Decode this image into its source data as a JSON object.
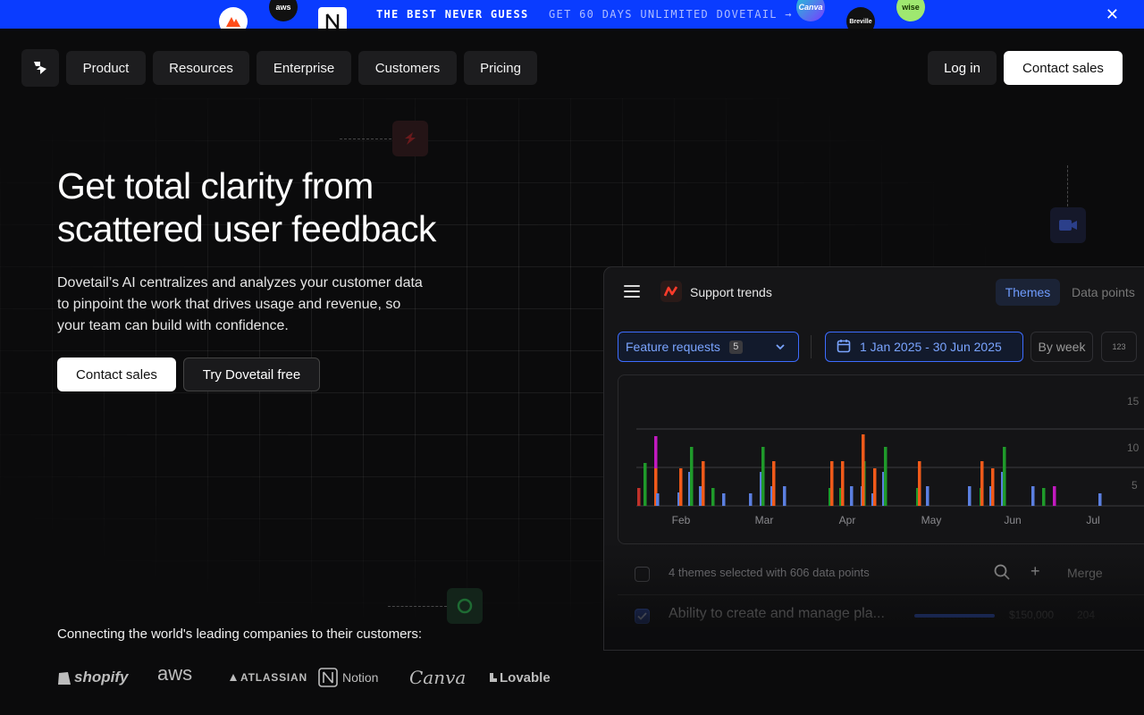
{
  "banner": {
    "headline": "THE BEST NEVER GUESS",
    "cta": "GET 60 DAYS UNLIMITED DOVETAIL →",
    "close_icon": "close-icon",
    "logos": [
      "aws",
      "Canva",
      "Breville",
      "wise"
    ]
  },
  "nav": {
    "items": [
      "Product",
      "Resources",
      "Enterprise",
      "Customers",
      "Pricing"
    ],
    "login": "Log in",
    "contact": "Contact sales"
  },
  "hero": {
    "title_line1": "Get total clarity from",
    "title_line2": "scattered user feedback",
    "description": "Dovetail’s AI centralizes and analyzes your customer data to pinpoint the work that drives usage and revenue, so your team can build with confidence.",
    "primary_cta": "Contact sales",
    "secondary_cta": "Try Dovetail free"
  },
  "panel": {
    "title": "Support trends",
    "tabs": [
      "Themes",
      "Data points"
    ],
    "filter_label": "Feature requests",
    "filter_count": "5",
    "date_range": "1 Jan 2025 - 30 Jun 2025",
    "grouping": "By week",
    "number_toggle": "123",
    "selection_summary": "4 themes selected with 606 data points",
    "merge": "Merge",
    "theme_row": {
      "title": "Ability to create and manage pla...",
      "value": "$150,000",
      "count": "204"
    },
    "side_ticks": [
      "15",
      "10",
      "5"
    ]
  },
  "chart_data": {
    "type": "bar",
    "x_ticks": [
      "Feb",
      "Mar",
      "Apr",
      "May",
      "Jun",
      "Jul"
    ],
    "colors": {
      "blue": "#5b7fe0",
      "green": "#1f9a2a",
      "orange": "#f05a1a",
      "magenta": "#c21ac0",
      "red": "#c0322a"
    }
  },
  "logos": {
    "caption": "Connecting the world's leading companies to their customers:",
    "items": [
      "shopify",
      "aws",
      "ATLASSIAN",
      "Notion",
      "Canva",
      "Lovable"
    ]
  }
}
